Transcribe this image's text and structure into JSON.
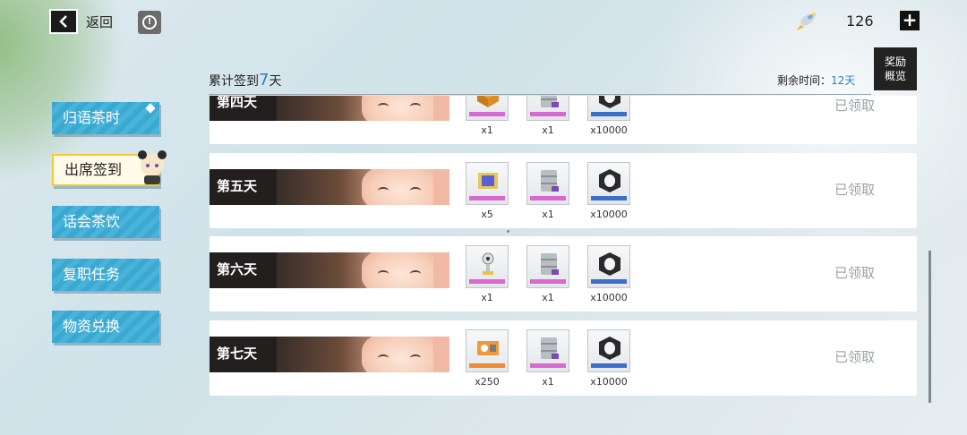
{
  "topbar": {
    "back_label": "返回",
    "currency_value": "126",
    "plus_label": "+",
    "reward_overview_label": "奖励\n概览"
  },
  "header": {
    "cumulative_prefix": "累计签到",
    "cumulative_days": "7",
    "cumulative_suffix": "天",
    "remaining_label": "剩余时间：",
    "remaining_value": "12天"
  },
  "sidebar": {
    "items": [
      {
        "label": "归语茶时"
      },
      {
        "label": "出席签到"
      },
      {
        "label": "话会茶饮"
      },
      {
        "label": "复职任务"
      },
      {
        "label": "物资兑换"
      }
    ]
  },
  "days": [
    {
      "label": "第四天",
      "status": "已领取",
      "rewards": [
        {
          "icon": "orange-crate-icon",
          "qty": "x1",
          "color": "#f0a030",
          "tag": "#d968d0"
        },
        {
          "icon": "canister-icon",
          "qty": "x1",
          "color": "#b9bec2",
          "tag": "#d968d0"
        },
        {
          "icon": "black-nut-icon",
          "qty": "x10000",
          "color": "#2a2a2a",
          "tag": "#3c6fc9"
        }
      ]
    },
    {
      "label": "第五天",
      "status": "已领取",
      "rewards": [
        {
          "icon": "chip-icon",
          "qty": "x5",
          "color": "#5a5fd6",
          "tag": "#d968d0"
        },
        {
          "icon": "canister-icon",
          "qty": "x1",
          "color": "#b9bec2",
          "tag": "#d968d0"
        },
        {
          "icon": "black-nut-icon",
          "qty": "x10000",
          "color": "#2a2a2a",
          "tag": "#3c6fc9"
        }
      ]
    },
    {
      "label": "第六天",
      "status": "已领取",
      "rewards": [
        {
          "icon": "probe-icon",
          "qty": "x1",
          "color": "#d8dde0",
          "tag": "#d968d0"
        },
        {
          "icon": "canister-icon",
          "qty": "x1",
          "color": "#b9bec2",
          "tag": "#d968d0"
        },
        {
          "icon": "black-nut-icon",
          "qty": "x10000",
          "color": "#2a2a2a",
          "tag": "#3c6fc9"
        }
      ]
    },
    {
      "label": "第七天",
      "status": "已领取",
      "rewards": [
        {
          "icon": "ticket-icon",
          "qty": "x250",
          "color": "#f09a3c",
          "tag": "#f08a30"
        },
        {
          "icon": "canister-icon",
          "qty": "x1",
          "color": "#b9bec2",
          "tag": "#d968d0"
        },
        {
          "icon": "black-nut-icon",
          "qty": "x10000",
          "color": "#2a2a2a",
          "tag": "#3c6fc9"
        }
      ]
    }
  ]
}
